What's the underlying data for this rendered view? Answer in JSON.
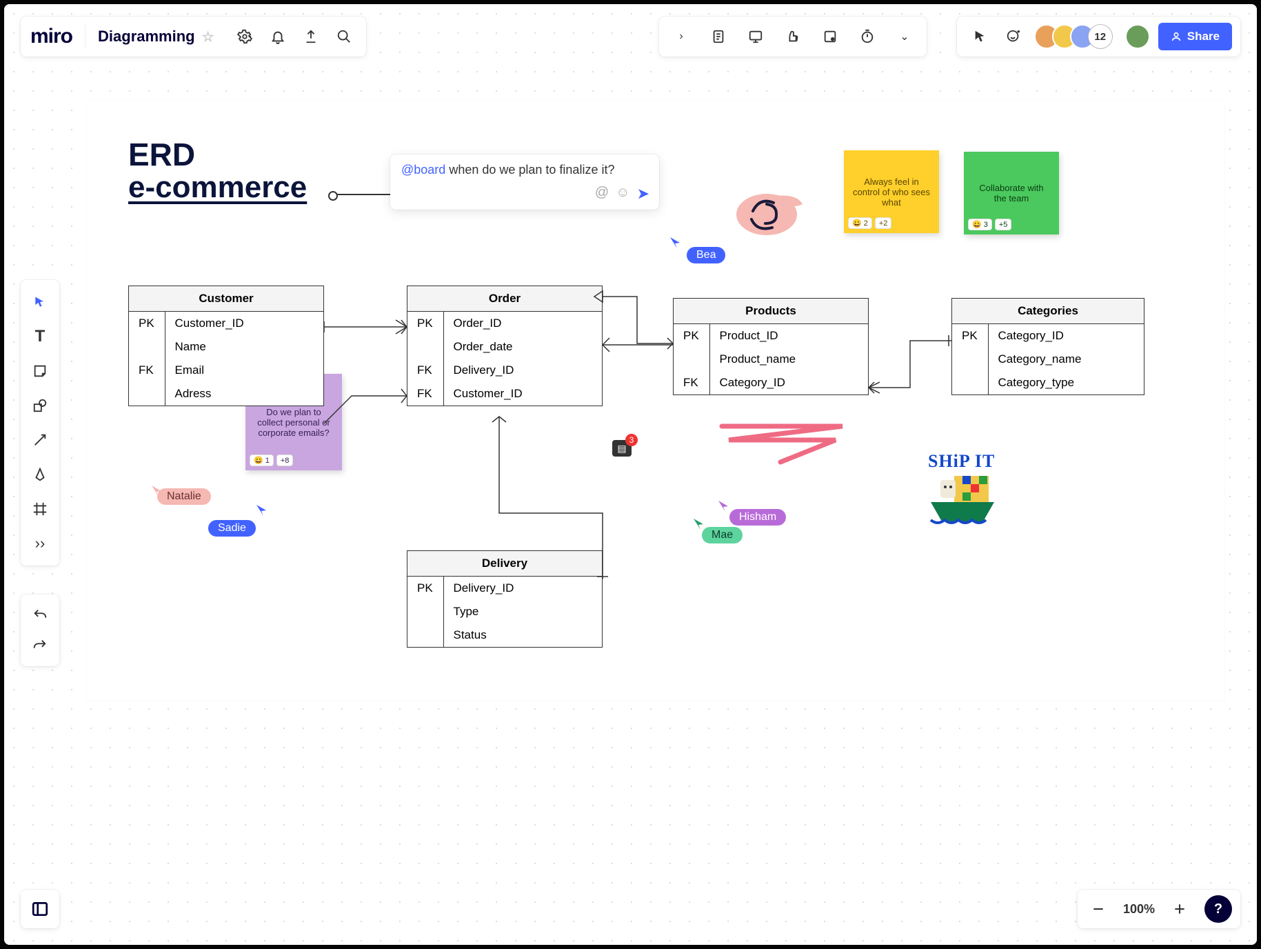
{
  "header": {
    "logo": "miro",
    "board_name": "Diagramming",
    "collaborator_count": "12",
    "share_label": "Share"
  },
  "zoom": {
    "level": "100%"
  },
  "canvas_title": {
    "line1": "ERD",
    "line2": "e-commerce"
  },
  "comment_input": {
    "mention": "@board",
    "text": " when do we plan to finalize it?"
  },
  "cursors": {
    "bea": "Bea",
    "natalie": "Natalie",
    "sadie": "Sadie",
    "hisham": "Hisham",
    "mae": "Mae"
  },
  "stickies": {
    "yellow": {
      "text": "Always feel in control of who sees what",
      "react1": "2",
      "react2": "+2"
    },
    "green": {
      "text": "Collaborate with the team",
      "react1": "3",
      "react2": "+5"
    },
    "purple": {
      "text": "Do we plan to collect personal or corporate emails?",
      "react1": "1",
      "react2": "+8"
    }
  },
  "ship_label": "SHiP IT",
  "chat_badge_count": "3",
  "tables": {
    "customer": {
      "title": "Customer",
      "rows": [
        {
          "k": "PK",
          "f": "Customer_ID"
        },
        {
          "k": "",
          "f": "Name"
        },
        {
          "k": "FK",
          "f": "Email"
        },
        {
          "k": "",
          "f": "Adress"
        }
      ]
    },
    "order": {
      "title": "Order",
      "rows": [
        {
          "k": "PK",
          "f": "Order_ID"
        },
        {
          "k": "",
          "f": "Order_date"
        },
        {
          "k": "FK",
          "f": "Delivery_ID"
        },
        {
          "k": "FK",
          "f": "Customer_ID"
        }
      ]
    },
    "products": {
      "title": "Products",
      "rows": [
        {
          "k": "PK",
          "f": "Product_ID"
        },
        {
          "k": "",
          "f": "Product_name"
        },
        {
          "k": "FK",
          "f": "Category_ID"
        }
      ]
    },
    "categories": {
      "title": "Categories",
      "rows": [
        {
          "k": "PK",
          "f": "Category_ID"
        },
        {
          "k": "",
          "f": "Category_name"
        },
        {
          "k": "",
          "f": "Category_type"
        }
      ]
    },
    "delivery": {
      "title": "Delivery",
      "rows": [
        {
          "k": "PK",
          "f": "Delivery_ID"
        },
        {
          "k": "",
          "f": "Type"
        },
        {
          "k": "",
          "f": "Status"
        }
      ]
    }
  }
}
